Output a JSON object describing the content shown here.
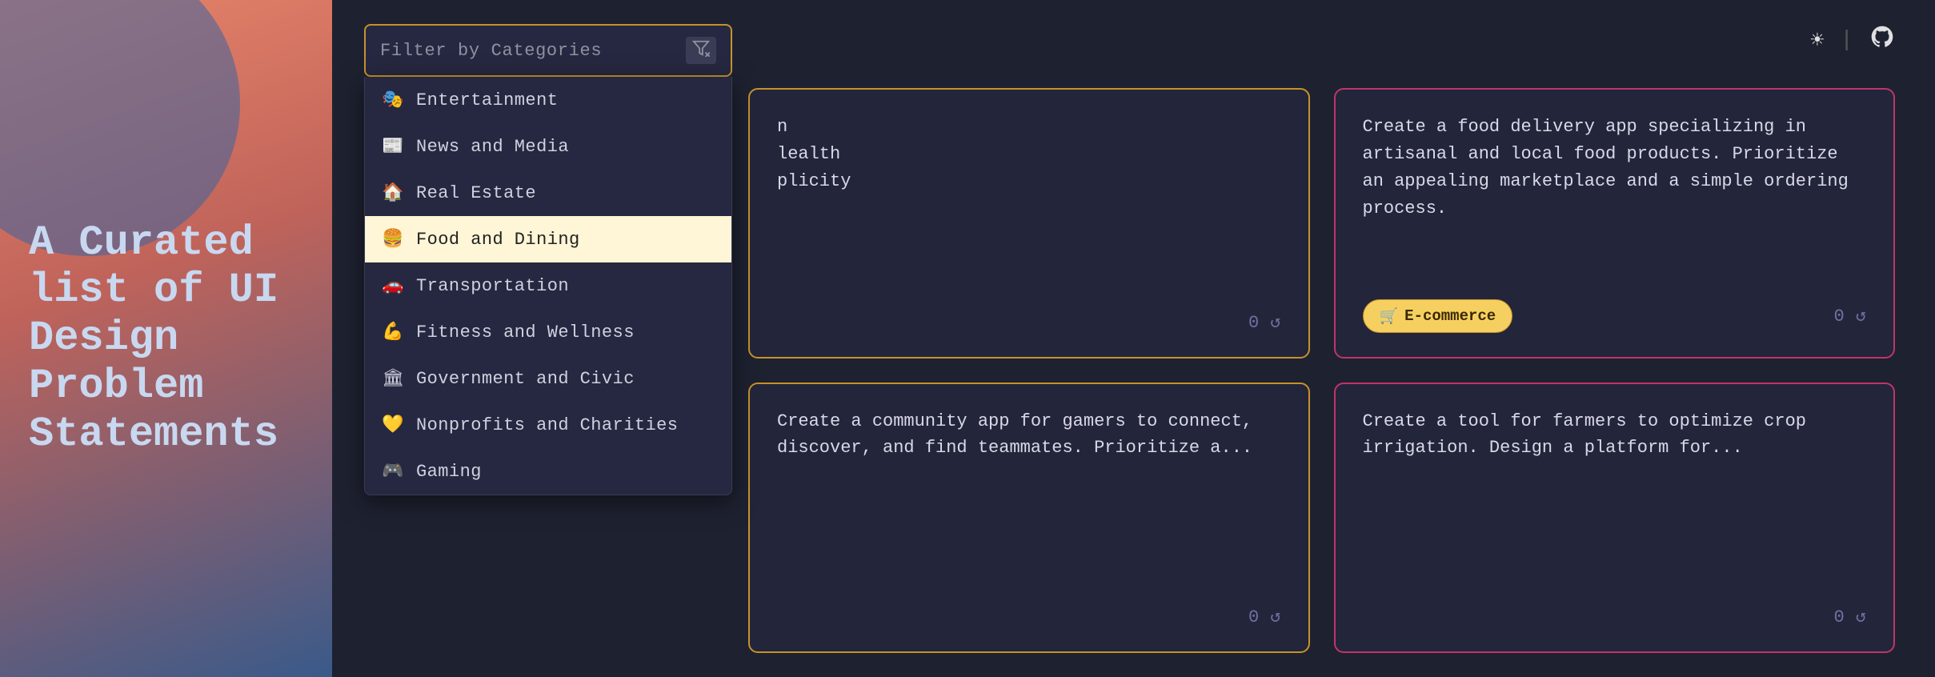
{
  "sidebar": {
    "title": "A Curated list of UI Design Problem Statements"
  },
  "header": {
    "filter_placeholder": "Filter by Categories",
    "clear_icon": "⌫",
    "sun_icon": "☀",
    "github_icon": "⊙"
  },
  "dropdown": {
    "items": [
      {
        "emoji": "🎭",
        "label": "Entertainment",
        "selected": false
      },
      {
        "emoji": "📰",
        "label": "News and Media",
        "selected": false
      },
      {
        "emoji": "🏠",
        "label": "Real Estate",
        "selected": false
      },
      {
        "emoji": "🍔",
        "label": "Food and Dining",
        "selected": true
      },
      {
        "emoji": "🚗",
        "label": "Transportation",
        "selected": false
      },
      {
        "emoji": "💪",
        "label": "Fitness and Wellness",
        "selected": false
      },
      {
        "emoji": "🏛",
        "label": "Government and Civic",
        "selected": false
      },
      {
        "emoji": "💛",
        "label": "Nonprofits and Charities",
        "selected": false
      },
      {
        "emoji": "🎮",
        "label": "Gaming",
        "selected": false
      }
    ]
  },
  "cards": [
    {
      "id": "card1",
      "border": "yellow",
      "text": "n\nlealth\nplicity",
      "badge": null,
      "actions": {
        "count": "0"
      }
    },
    {
      "id": "card2",
      "border": "pink",
      "text": "Create a food delivery app specializing in artisanal and local food products. Prioritize an appealing marketplace and a simple ordering process.",
      "badge_emoji": "🛒",
      "badge_label": "E-commerce",
      "badge_type": "yellow",
      "actions": {
        "count": "0"
      }
    },
    {
      "id": "card3",
      "border": "yellow",
      "text": "Create a community app for gamers to connect, discover, and find teammates. Prioritize a...",
      "badge": null,
      "actions": {
        "count": "0"
      }
    },
    {
      "id": "card4",
      "border": "pink",
      "text": "Create a tool for farmers to optimize crop irrigation. Design a platform for...",
      "badge": null,
      "actions": {
        "count": "0"
      }
    }
  ]
}
